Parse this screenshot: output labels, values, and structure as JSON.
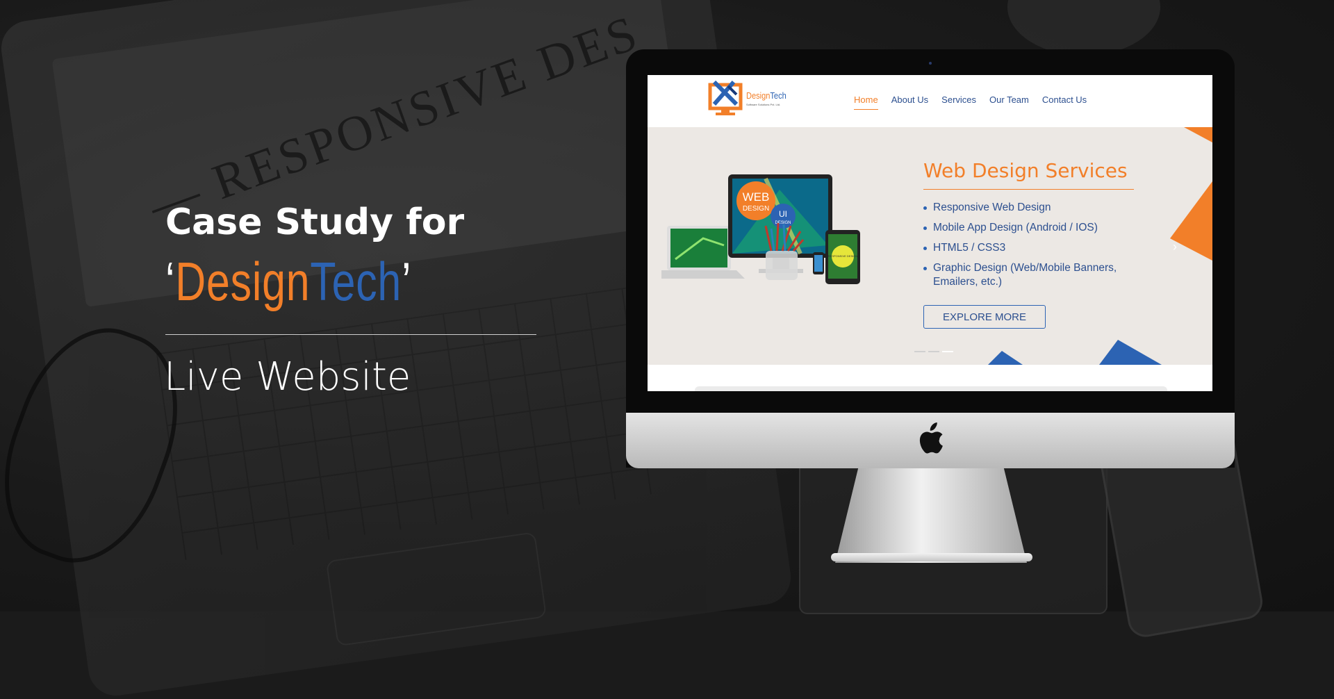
{
  "background": {
    "decor_text": "— RESPONSIVE DES"
  },
  "hero": {
    "heading": "Case Study for",
    "brand_open_quote": "‘",
    "brand_orange": "Design",
    "brand_blue": "Tech",
    "brand_close_quote": "’",
    "subheading": "Live Website"
  },
  "site": {
    "logo": {
      "name_orange": "Design",
      "name_blue": "Tech",
      "tagline": "Software Solutions Pvt. Ltd."
    },
    "nav": [
      "Home",
      "About Us",
      "Services",
      "Our Team",
      "Contact Us"
    ],
    "active_nav": "Home",
    "banner": {
      "title": "Web Design Services",
      "services": [
        "Responsive Web Design",
        "Mobile App Design (Android / IOS)",
        "HTML5 / CSS3",
        "Graphic Design (Web/Mobile Banners, Emailers, etc.)"
      ],
      "cta": "EXPLORE MORE",
      "badge_web": "WEB",
      "badge_design": "DESIGN",
      "badge_ui": "UI",
      "badge_ui_design": "DESIGN",
      "tablet_label": "RESPONSIVE DESIGN",
      "next_icon": "chevron-right-icon"
    }
  },
  "colors": {
    "orange": "#f27f29",
    "blue": "#2c63b3"
  }
}
